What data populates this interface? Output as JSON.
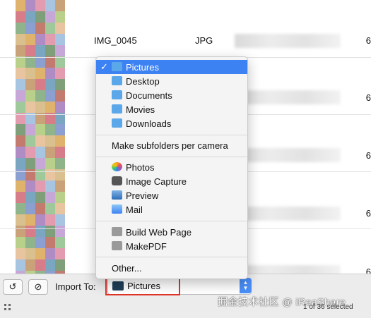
{
  "list": {
    "rows": [
      {
        "name": "IMG_0045",
        "type": "JPG",
        "num": "6"
      },
      {
        "name": "",
        "type": "",
        "num": "6"
      },
      {
        "name": "",
        "type": "",
        "num": "6"
      },
      {
        "name": "",
        "type": "",
        "num": "6"
      },
      {
        "name": "",
        "type": "",
        "num": "6"
      }
    ]
  },
  "menu": {
    "folders": [
      {
        "label": "Pictures",
        "icon": "pictures-folder-icon",
        "checked": "✓"
      },
      {
        "label": "Desktop",
        "icon": "desktop-folder-icon"
      },
      {
        "label": "Documents",
        "icon": "documents-folder-icon"
      },
      {
        "label": "Movies",
        "icon": "movies-folder-icon"
      },
      {
        "label": "Downloads",
        "icon": "downloads-folder-icon"
      }
    ],
    "subfolders": "Make subfolders per camera",
    "apps": [
      {
        "label": "Photos",
        "icon": "photos-app-icon"
      },
      {
        "label": "Image Capture",
        "icon": "image-capture-app-icon"
      },
      {
        "label": "Preview",
        "icon": "preview-app-icon"
      },
      {
        "label": "Mail",
        "icon": "mail-app-icon"
      }
    ],
    "workflows": [
      {
        "label": "Build Web Page",
        "icon": "workflow-icon"
      },
      {
        "label": "MakePDF",
        "icon": "workflow-icon"
      }
    ],
    "other": "Other..."
  },
  "bottom": {
    "rotate_icon": "↺",
    "delete_icon": "⊘",
    "import_label": "Import To:",
    "import_value": "Pictures",
    "selection": "1 of 36 selected",
    "watermark": "掘金技术社区 @ iReaShare"
  },
  "colors": {
    "selection": "#3d82f3",
    "highlight_border": "#e0342a"
  }
}
